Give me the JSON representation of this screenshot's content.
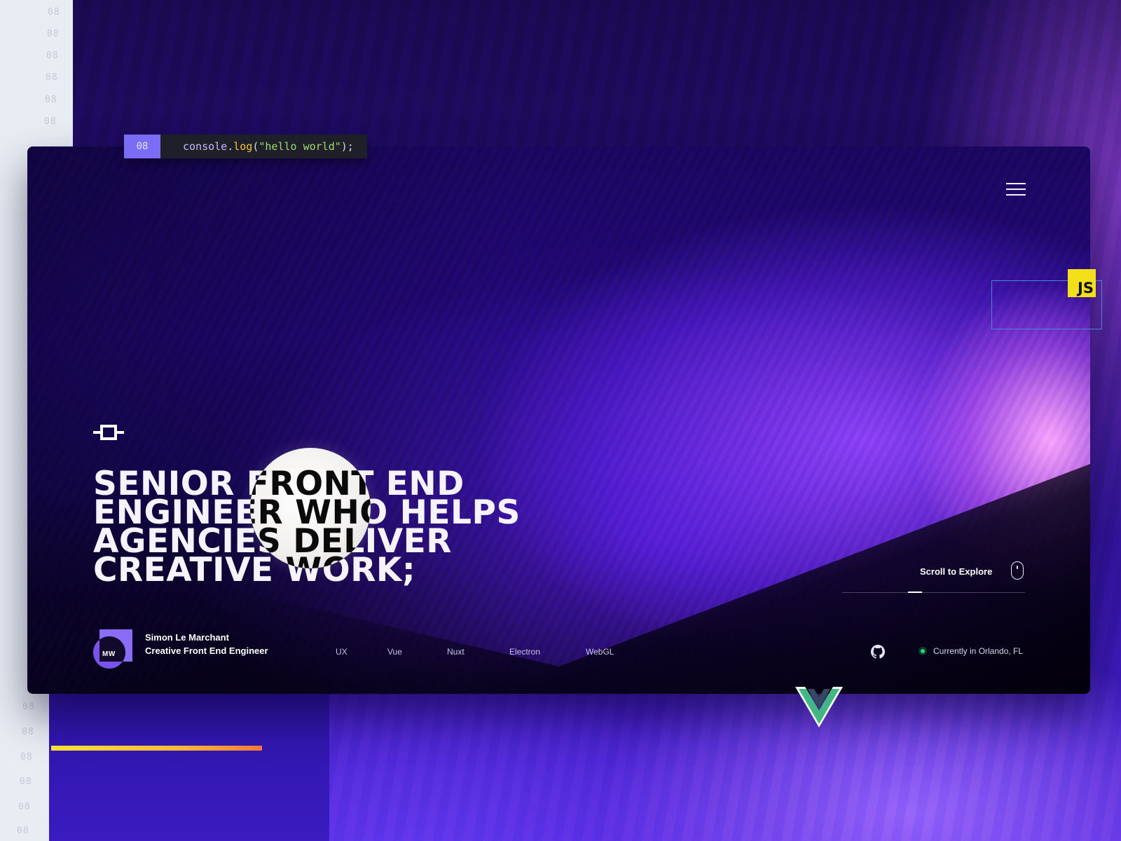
{
  "gutter": {
    "line_label": "08"
  },
  "console": {
    "line_number": "08",
    "code_object": "console",
    "code_dot": ".",
    "code_method": "log",
    "code_paren_open": "(",
    "code_string": "\"hello world\"",
    "code_paren_close": ");"
  },
  "hero": {
    "headline_lines": [
      "SENIOR FRONT END",
      "ENGINEER WHO HELPS",
      "AGENCIES DELIVER",
      "CREATIVE WORK;"
    ]
  },
  "badges": {
    "js_label": "JS"
  },
  "scroll": {
    "label": "Scroll to Explore",
    "progress_fraction": 0.08
  },
  "profile": {
    "initials": "MW",
    "name": "Simon Le Marchant",
    "role": "Creative Front End Engineer"
  },
  "tech_stack": [
    "UX",
    "Vue",
    "Nuxt",
    "Electron",
    "WebGL"
  ],
  "status": {
    "location": "Currently in Orlando, FL",
    "indicator_color": "#2fd07a"
  },
  "icons": {
    "menu": "hamburger-menu-icon",
    "scroll": "mouse-icon",
    "social": "github-icon",
    "framework": "vue-logo-icon",
    "brand_mark": "brand-mark-icon"
  },
  "loading_bar": {
    "progress_fraction": 0.43
  },
  "colors": {
    "accent": "#7b6cf6",
    "js_yellow": "#f4df1b",
    "vue_green": "#41b883",
    "vue_dark": "#35495e"
  }
}
